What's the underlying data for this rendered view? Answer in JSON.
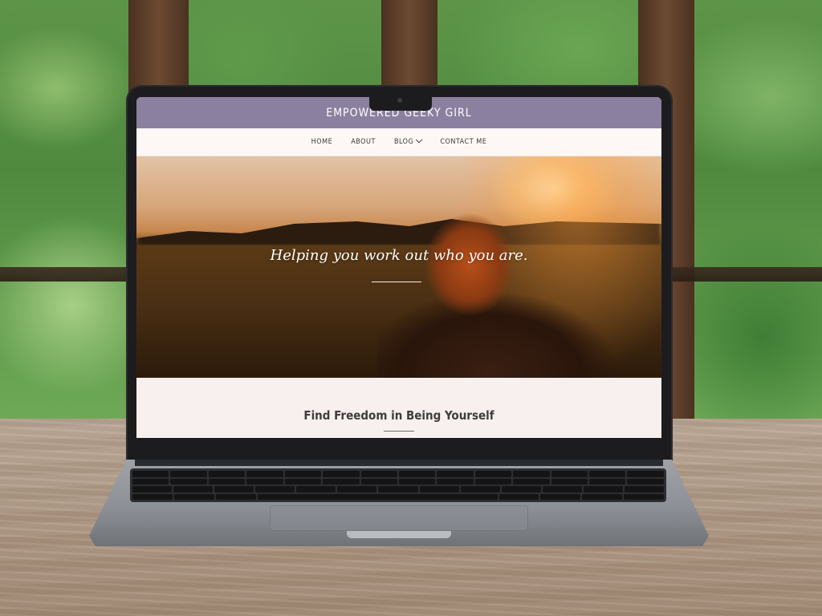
{
  "site": {
    "title": "EMPOWERED GEEKY GIRL"
  },
  "nav": {
    "items": [
      {
        "label": "HOME"
      },
      {
        "label": "ABOUT"
      },
      {
        "label": "BLOG"
      },
      {
        "label": "CONTACT ME"
      }
    ]
  },
  "hero": {
    "tagline": "Helping you work out who you are."
  },
  "intro": {
    "heading": "Find Freedom in Being Yourself"
  },
  "colors": {
    "header_bg": "#8b809f",
    "nav_bg": "#fdf8f5",
    "page_bg": "#f7f0ee"
  },
  "icons": {
    "blog_dropdown": "chevron-down-icon"
  }
}
